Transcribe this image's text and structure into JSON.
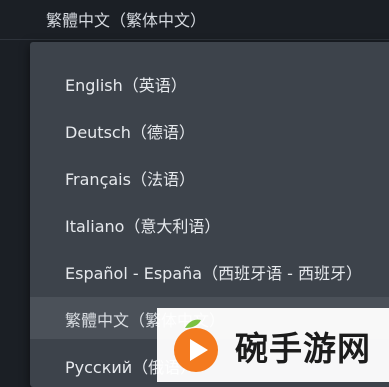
{
  "language_select": {
    "current_value": "繁體中文（繁体中文）"
  },
  "language_dropdown": {
    "options": [
      {
        "label": "English（英语）"
      },
      {
        "label": "Deutsch（德语）"
      },
      {
        "label": "Français（法语）"
      },
      {
        "label": "Italiano（意大利语）"
      },
      {
        "label": "Español - España（西班牙语 - 西班牙）"
      },
      {
        "label": "繁體中文（繁体中文）",
        "selected": true
      },
      {
        "label": "Русский（俄语）"
      }
    ]
  },
  "watermark": {
    "text": "碗手游网",
    "icon": "orange-play-logo-icon"
  },
  "colors": {
    "background": "#1b1f25",
    "dropdown_bg": "#3d434b",
    "selected_bg": "#4b5159",
    "text": "#e6e9ed",
    "logo_orange": "#f47a1f",
    "logo_green": "#7ac142"
  }
}
